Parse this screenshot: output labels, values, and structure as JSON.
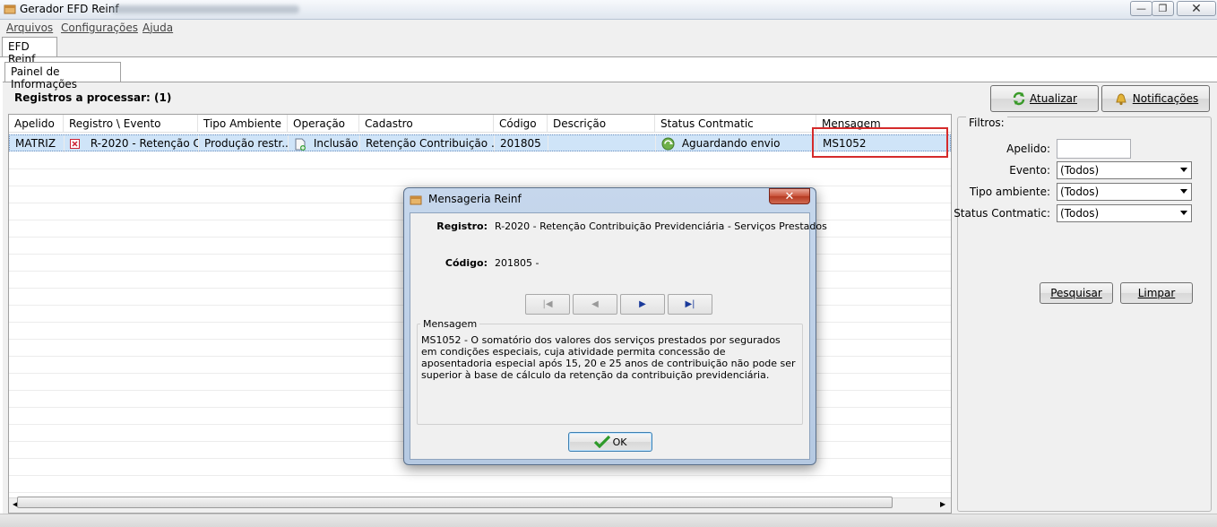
{
  "window": {
    "title": "Gerador EFD Reinf",
    "controls": {
      "minimize": "—",
      "maximize": "❐",
      "close": "✕"
    }
  },
  "menu": [
    "Arquivos",
    "Configurações",
    "Ajuda"
  ],
  "tabs": {
    "outer": "EFD Reinf",
    "inner": "Painel de Informações"
  },
  "header": {
    "registros_label": "Registros a processar: (1)",
    "atualizar_label": "Atualizar",
    "notificacoes_label": "Notificações"
  },
  "grid": {
    "columns": [
      "Apelido",
      "Registro \\ Evento",
      "Tipo Ambiente",
      "Operação",
      "Cadastro",
      "Código",
      "Descrição",
      "Status Contmatic",
      "Mensagem"
    ],
    "rows": [
      {
        "apelido": "MATRIZ",
        "registro": "R-2020 - Retenção C...",
        "tipo_ambiente": "Produção restr...",
        "operacao": "Inclusão",
        "cadastro": "Retenção Contribuição ...",
        "codigo": "201805",
        "descricao": "",
        "status": "Aguardando envio",
        "mensagem": "MS1052"
      }
    ]
  },
  "filters": {
    "title": "Filtros:",
    "apelido_label": "Apelido:",
    "apelido_value": "",
    "evento_label": "Evento:",
    "evento_value": "(Todos)",
    "tipo_label": "Tipo ambiente:",
    "tipo_value": "(Todos)",
    "status_label": "Status Contmatic:",
    "status_value": "(Todos)",
    "pesquisar_label": "Pesquisar",
    "limpar_label": "Limpar"
  },
  "dialog": {
    "title": "Mensageria Reinf",
    "close": "✕",
    "registro_label": "Registro:",
    "registro_value": "R-2020 - Retenção Contribuição Previdenciária - Serviços Prestados",
    "codigo_label": "Código:",
    "codigo_value": "201805 -",
    "nav": {
      "first": "|◀",
      "prev": "◀",
      "next": "▶",
      "last": "▶|"
    },
    "mensagem_title": "Mensagem",
    "mensagem_text": "MS1052 - O somatório dos valores dos serviços prestados por segurados em condições especiais, cuja atividade permita concessão de aposentadoria especial após 15, 20 e 25 anos de contribuição não pode ser superior à base de cálculo da retenção da contribuição previdenciária.",
    "ok_label": "OK"
  },
  "colors": {
    "selection": "#cfe4f8",
    "highlight": "#d52b2b",
    "dialog_frame": "#b5c9e2"
  }
}
